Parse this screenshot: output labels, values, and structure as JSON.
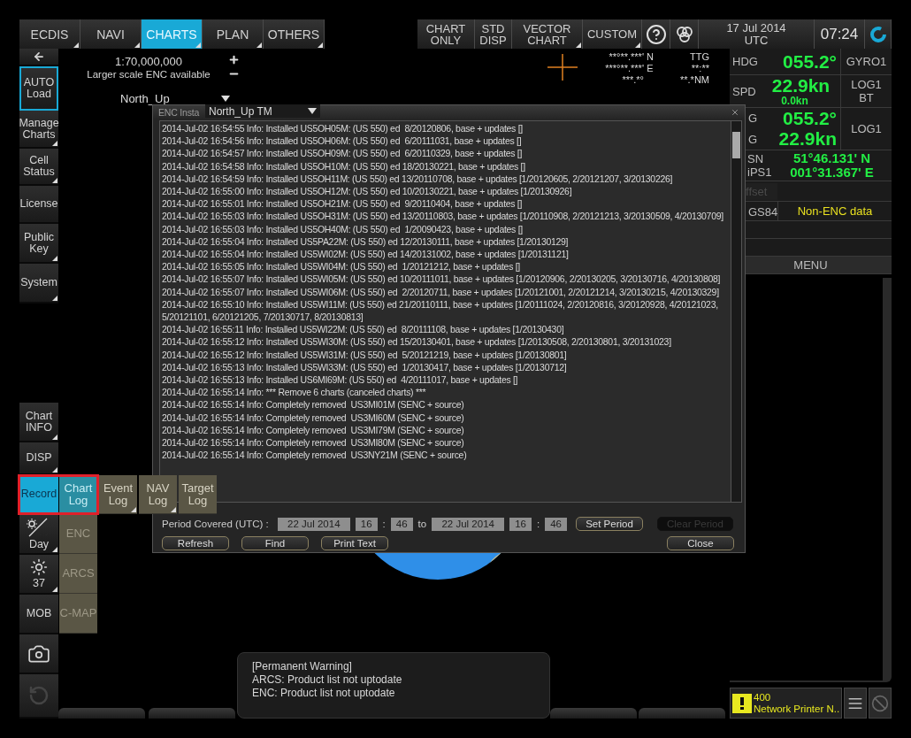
{
  "top_bar": {
    "tabs": [
      {
        "label": "ECDIS",
        "selected": false,
        "submenu": true
      },
      {
        "label": "NAVI",
        "selected": false,
        "submenu": true
      },
      {
        "label": "CHARTS",
        "selected": true,
        "submenu": true
      },
      {
        "label": "PLAN",
        "selected": false,
        "submenu": true
      },
      {
        "label": "OTHERS",
        "selected": false,
        "submenu": true
      }
    ],
    "display_buttons": [
      {
        "label": "CHART ONLY",
        "submenu": false
      },
      {
        "label": "STD DISP",
        "submenu": false
      },
      {
        "label": "VECTOR CHART",
        "submenu": true
      },
      {
        "label": "CUSTOM",
        "submenu": true
      }
    ],
    "date": "17 Jul 2014",
    "timezone": "UTC",
    "time": "07:24"
  },
  "sidebar": {
    "upper": [
      {
        "kind": "back",
        "selected": false,
        "outlined": false,
        "submenu": false
      },
      {
        "kind": "text",
        "label": "AUTO Load",
        "selected": false,
        "outlined": true,
        "submenu": false
      },
      {
        "kind": "text",
        "label": "Manage Charts",
        "selected": false,
        "outlined": false,
        "submenu": true
      },
      {
        "kind": "text",
        "label": "Cell Status",
        "selected": false,
        "outlined": false,
        "submenu": true
      },
      {
        "kind": "text",
        "label": "License",
        "selected": false,
        "outlined": false,
        "submenu": false
      },
      {
        "kind": "text",
        "label": "Public Key",
        "selected": false,
        "outlined": false,
        "submenu": true
      },
      {
        "kind": "text",
        "label": "System",
        "selected": false,
        "outlined": false,
        "submenu": true
      }
    ],
    "lower": [
      {
        "kind": "text",
        "label": "Chart INFO",
        "selected": false,
        "disabled": false,
        "submenu": true
      },
      {
        "kind": "text",
        "label": "DISP",
        "selected": false,
        "disabled": false,
        "submenu": true
      },
      {
        "kind": "text",
        "label": "Record",
        "selected": true,
        "disabled": false,
        "submenu": false
      },
      {
        "kind": "daynight",
        "label": "Day",
        "selected": false,
        "disabled": false,
        "submenu": true
      },
      {
        "kind": "brightness",
        "label": "37",
        "selected": false,
        "disabled": false,
        "submenu": true
      },
      {
        "kind": "text",
        "label": "MOB",
        "selected": false,
        "disabled": false,
        "submenu": false
      },
      {
        "kind": "camera",
        "selected": false,
        "disabled": false,
        "submenu": false
      },
      {
        "kind": "undo",
        "selected": false,
        "disabled": true,
        "submenu": false
      }
    ]
  },
  "record_menu": {
    "marked": true,
    "logs": [
      {
        "label": "Chart Log",
        "selected": true,
        "submenu": false
      },
      {
        "label": "Event Log",
        "selected": false,
        "submenu": true
      },
      {
        "label": "NAV Log",
        "selected": false,
        "submenu": true
      },
      {
        "label": "Target Log",
        "selected": false,
        "submenu": false
      }
    ],
    "sources": [
      {
        "label": "ENC"
      },
      {
        "label": "ARCS"
      },
      {
        "label": "C-MAP"
      }
    ]
  },
  "chart": {
    "scale": "1:70,000,000",
    "scale_note": "Larger scale ENC available",
    "orientation": "North_Up",
    "motion_mode": "North_Up TM",
    "cursor": [
      {
        "position": "**°**.***'",
        "hemisphere": "N",
        "value": "TTG"
      },
      {
        "position": "***°**.***'",
        "hemisphere": "E",
        "value": "**:**"
      },
      {
        "position": "***.*°",
        "value": "**.*NM"
      }
    ]
  },
  "dialog": {
    "title": "ENC Insta",
    "entries": [
      "2014-Jul-02 16:54:55 Info: Installed US5OH05M: (US 550) ed  8/20120806, base + updates []",
      "2014-Jul-02 16:54:56 Info: Installed US5OH06M: (US 550) ed  6/20111031, base + updates []",
      "2014-Jul-02 16:54:57 Info: Installed US5OH09M: (US 550) ed  6/20110329, base + updates []",
      "2014-Jul-02 16:54:58 Info: Installed US5OH10M: (US 550) ed 18/20130221, base + updates []",
      "2014-Jul-02 16:54:59 Info: Installed US5OH11M: (US 550) ed 13/20110708, base + updates [1/20120605, 2/20121207, 3/20130226]",
      "2014-Jul-02 16:55:00 Info: Installed US5OH12M: (US 550) ed 10/20130221, base + updates [1/20130926]",
      "2014-Jul-02 16:55:01 Info: Installed US5OH21M: (US 550) ed  9/20110404, base + updates []",
      "2014-Jul-02 16:55:03 Info: Installed US5OH31M: (US 550) ed 13/20110803, base + updates [1/20110908, 2/20121213, 3/20130509, 4/20130709]",
      "2014-Jul-02 16:55:03 Info: Installed US5OH40M: (US 550) ed  1/20090423, base + updates []",
      "2014-Jul-02 16:55:04 Info: Installed US5PA22M: (US 550) ed 12/20130111, base + updates [1/20130129]",
      "2014-Jul-02 16:55:04 Info: Installed US5WI02M: (US 550) ed 14/20131002, base + updates [1/20131121]",
      "2014-Jul-02 16:55:05 Info: Installed US5WI04M: (US 550) ed  1/20121212, base + updates []",
      "2014-Jul-02 16:55:07 Info: Installed US5WI05M: (US 550) ed 10/20111011, base + updates [1/20120906, 2/20130205, 3/20130716, 4/20130808]",
      "2014-Jul-02 16:55:07 Info: Installed US5WI06M: (US 550) ed  2/20120711, base + updates [1/20121001, 2/20121214, 3/20130215, 4/20130329]",
      "2014-Jul-02 16:55:10 Info: Installed US5WI11M: (US 550) ed 21/20110111, base + updates [1/20111024, 2/20120816, 3/20120928, 4/20121023, 5/20121101, 6/20121205, 7/20130717, 8/20130813]",
      "2014-Jul-02 16:55:11 Info: Installed US5WI22M: (US 550) ed  8/20111108, base + updates [1/20130430]",
      "2014-Jul-02 16:55:12 Info: Installed US5WI30M: (US 550) ed 15/20130401, base + updates [1/20130508, 2/20130801, 3/20131023]",
      "2014-Jul-02 16:55:12 Info: Installed US5WI31M: (US 550) ed  5/20121219, base + updates [1/20130801]",
      "2014-Jul-02 16:55:13 Info: Installed US5WI33M: (US 550) ed  1/20130417, base + updates [1/20130712]",
      "2014-Jul-02 16:55:13 Info: Installed US6MI69M: (US 550) ed  4/20111017, base + updates []",
      "2014-Jul-02 16:55:14 Info: *** Remove 6 charts (canceled charts) ***",
      "2014-Jul-02 16:55:14 Info: Completely removed  US3MI01M (SENC + source)",
      "2014-Jul-02 16:55:14 Info: Completely removed  US3MI60M (SENC + source)",
      "2014-Jul-02 16:55:14 Info: Completely removed  US3MI79M (SENC + source)",
      "2014-Jul-02 16:55:14 Info: Completely removed  US3MI80M (SENC + source)",
      "2014-Jul-02 16:55:14 Info: Completely removed  US3NY21M (SENC + source)"
    ],
    "period_label": "Period Covered (UTC) :",
    "from_date": "22 Jul 2014",
    "from_hour": "16",
    "from_separator": ":",
    "from_minute": "46",
    "to_label": "to",
    "to_date": "22 Jul 2014",
    "to_hour": "16",
    "to_separator": ":",
    "to_minute": "46",
    "period_buttons": [
      {
        "label": "Set Period",
        "disabled": false
      },
      {
        "label": "Clear Period",
        "disabled": true
      }
    ],
    "actions": [
      "Refresh",
      "Find",
      "Print Text"
    ],
    "close": "Close"
  },
  "nav_panel": {
    "heading": {
      "label": "HDG",
      "value": "055.2°",
      "source": "GYRO1"
    },
    "speed": {
      "label": "SPD",
      "value": "22.9kn",
      "sub_value": "0.0kn",
      "source": [
        "LOG1",
        "BT"
      ]
    },
    "course": {
      "label": "G",
      "value": "055.2°"
    },
    "ground_speed": {
      "label": "G",
      "value": "22.9kn"
    },
    "ground_source": "LOG1",
    "position": {
      "labels": [
        "SN",
        "iPS1"
      ],
      "latitude": "51°46.131' N",
      "longitude": "001°31.367' E"
    },
    "offset": "ffset",
    "datum": "GS84",
    "data_status": "Non-ENC data",
    "menu": "MENU"
  },
  "warning": {
    "title": "[Permanent Warning]",
    "lines": [
      "ARCS: Product list not uptodate",
      "ENC: Product list not uptodate"
    ]
  },
  "alert": {
    "code": "400",
    "message": "Network Printer N.."
  }
}
